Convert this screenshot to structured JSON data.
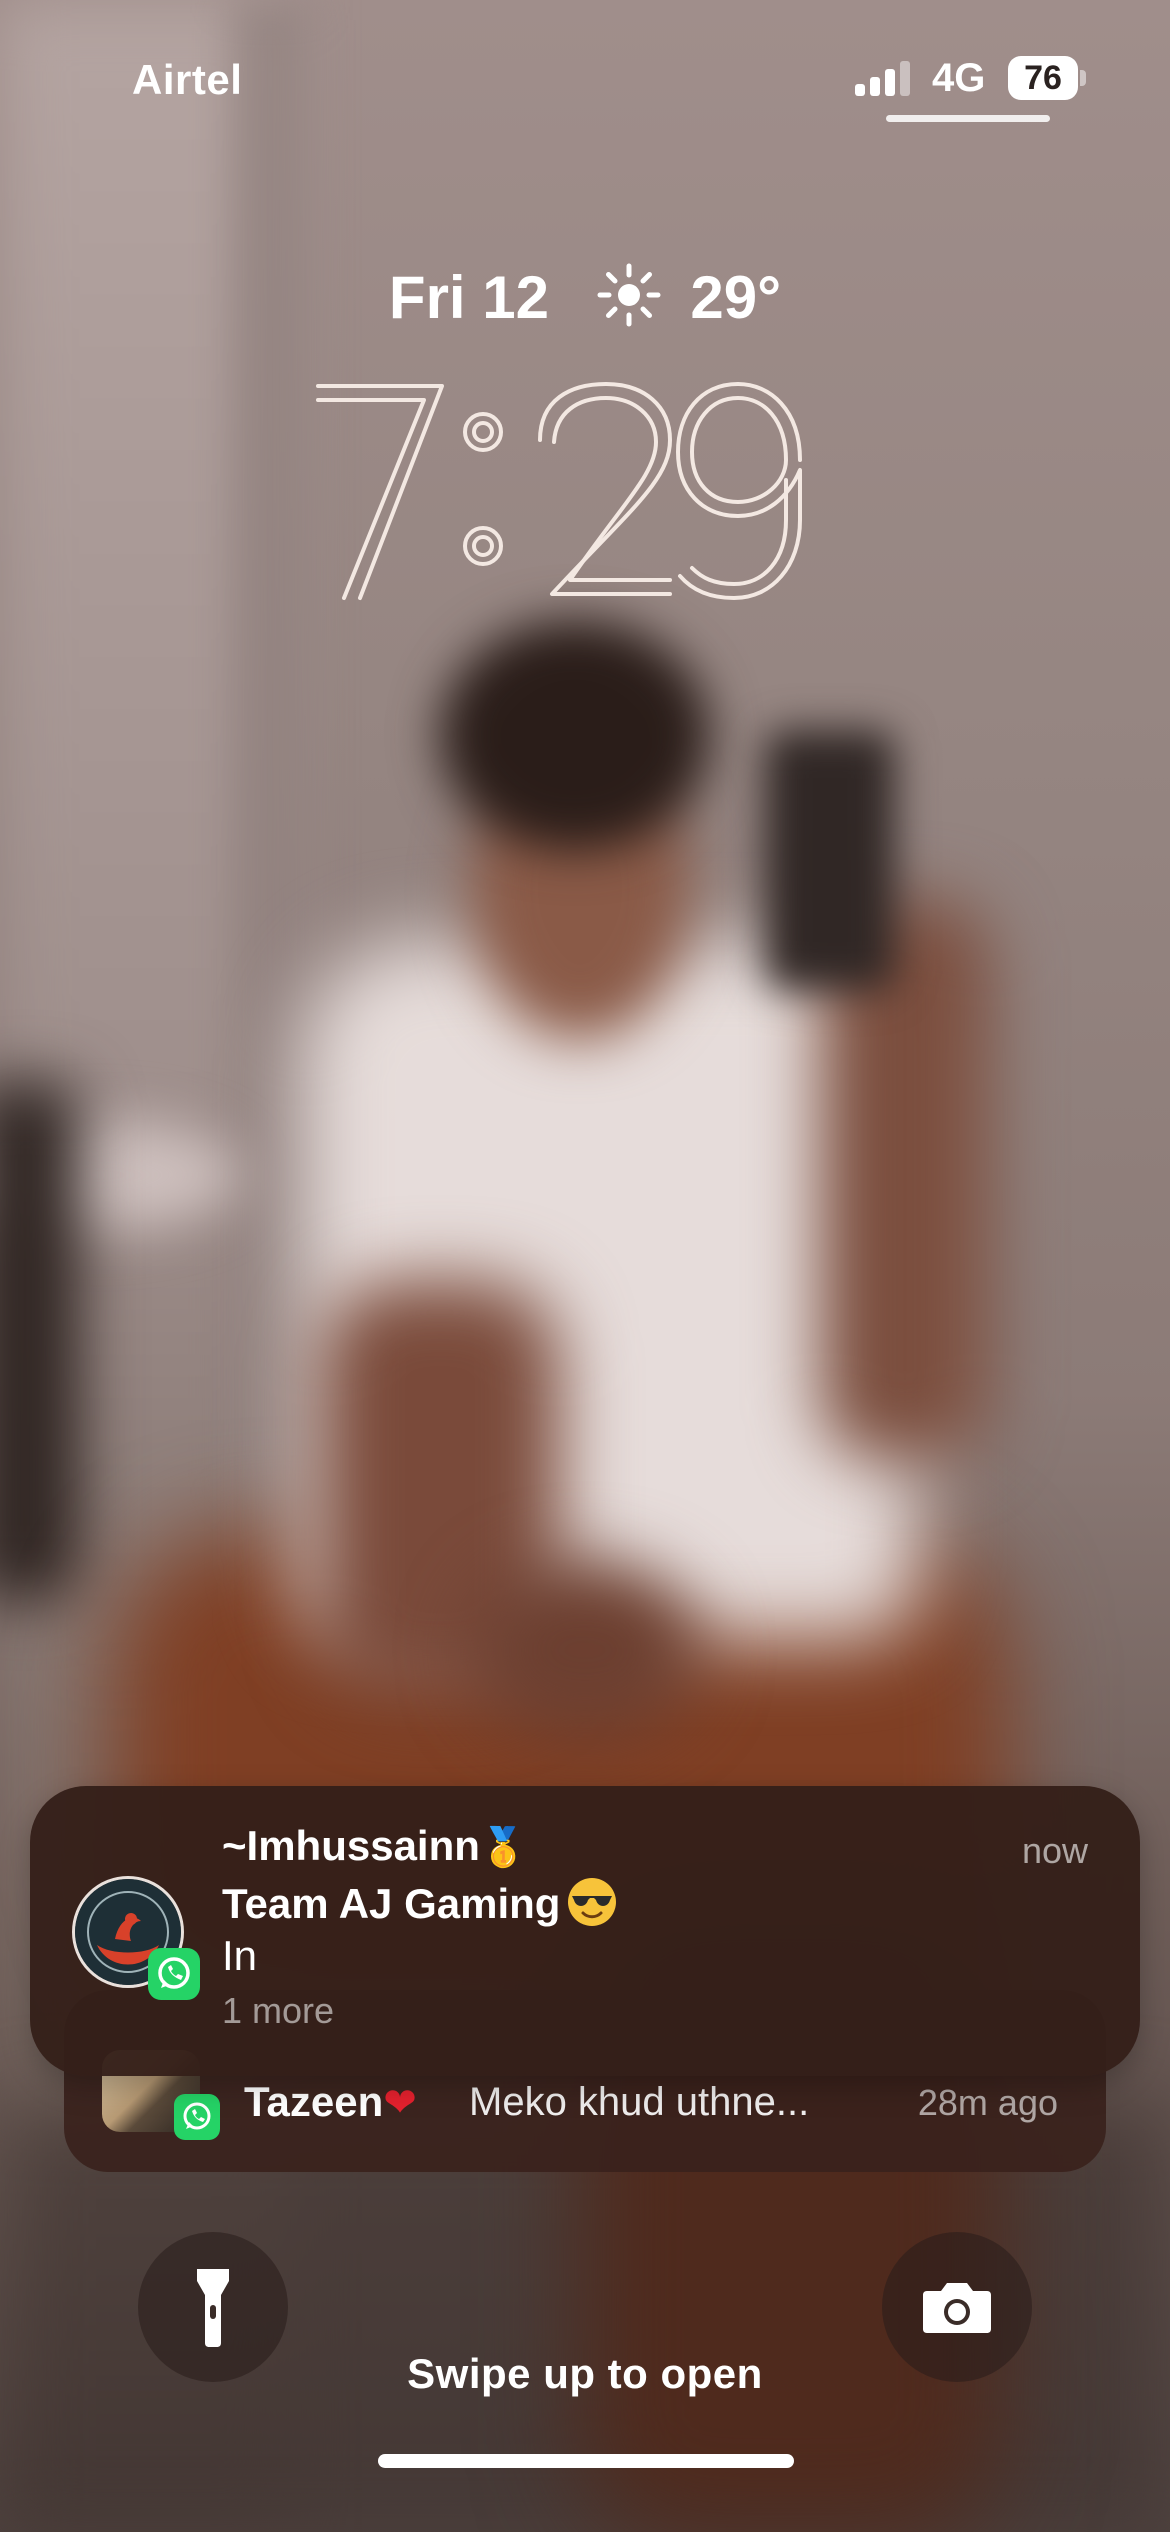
{
  "status_bar": {
    "carrier": "Airtel",
    "network": "4G",
    "battery_level": "76",
    "signal_bars": 3,
    "signal_bars_total": 4
  },
  "lockscreen": {
    "date": "Fri 12",
    "weather_icon": "sun-icon",
    "temperature": "29°",
    "time_hour": "7",
    "time_minute": "29"
  },
  "notifications": {
    "main": {
      "app_icon": "whatsapp-icon",
      "sender": "~Imhussainn",
      "sender_emoji": "🥇",
      "group": "Team AJ Gaming",
      "group_emoji": "😎",
      "message": "In",
      "more": "1 more",
      "time": "now"
    },
    "stacked": {
      "app_icon": "whatsapp-icon",
      "sender": "Tazeen",
      "sender_emoji": "❤",
      "message": "Meko khud uthne...",
      "time": "28m ago"
    }
  },
  "controls": {
    "flashlight_icon": "flashlight-icon",
    "camera_icon": "camera-icon",
    "swipe_hint": "Swipe up to open"
  },
  "colors": {
    "notification_bg": "#341f19",
    "whatsapp_green": "#25d366",
    "heart_red": "#e5212e"
  }
}
